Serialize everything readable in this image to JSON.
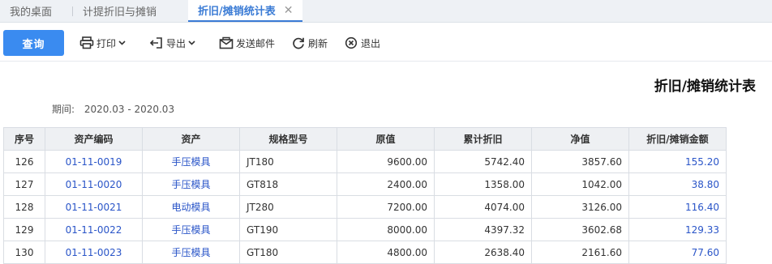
{
  "tabs": [
    {
      "label": "我的桌面",
      "active": false
    },
    {
      "label": "计提折旧与摊销",
      "active": false
    },
    {
      "label": "折旧/摊销统计表",
      "active": true
    }
  ],
  "toolbar": {
    "query_label": "查询",
    "print_label": "打印",
    "export_label": "导出",
    "email_label": "发送邮件",
    "refresh_label": "刷新",
    "exit_label": "退出"
  },
  "report": {
    "title": "折旧/摊销统计表",
    "period_label": "期间:",
    "period_value": "2020.03 - 2020.03"
  },
  "table": {
    "headers": [
      "序号",
      "资产编码",
      "资产",
      "规格型号",
      "原值",
      "累计折旧",
      "净值",
      "折旧/摊销金额"
    ],
    "rows": [
      [
        "126",
        "01-11-0019",
        "手压模具",
        "JT180",
        "9600.00",
        "5742.40",
        "3857.60",
        "155.20"
      ],
      [
        "127",
        "01-11-0020",
        "手压模具",
        "GT818",
        "2400.00",
        "1358.00",
        "1042.00",
        "38.80"
      ],
      [
        "128",
        "01-11-0021",
        "电动模具",
        "JT280",
        "7200.00",
        "4074.00",
        "3126.00",
        "116.40"
      ],
      [
        "129",
        "01-11-0022",
        "手压模具",
        "GT190",
        "8000.00",
        "4397.32",
        "3602.68",
        "129.33"
      ],
      [
        "130",
        "01-11-0023",
        "手压模具",
        "GT180",
        "4800.00",
        "2638.40",
        "2161.60",
        "77.60"
      ]
    ]
  },
  "colors": {
    "accent": "#3a8bf0",
    "link": "#2a55c8",
    "active_tab": "#3a7bd5"
  }
}
